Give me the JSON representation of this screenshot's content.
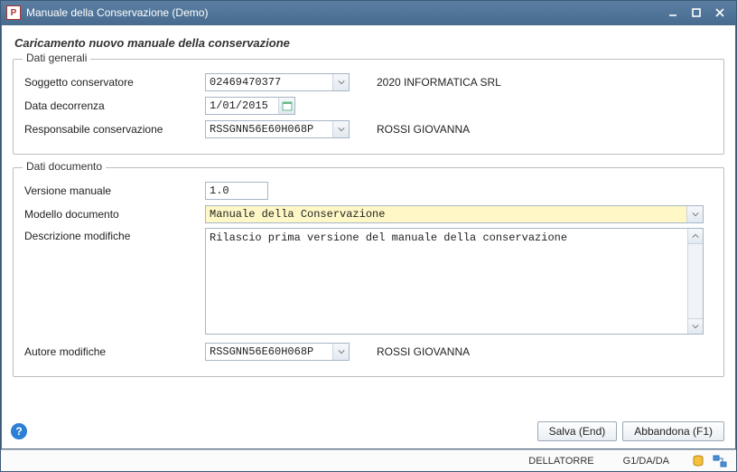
{
  "window": {
    "title": "Manuale della Conservazione  (Demo)"
  },
  "page_title": "Caricamento nuovo manuale della conservazione",
  "group_general": {
    "legend": "Dati generali",
    "subject_label": "Soggetto conservatore",
    "subject_value": "02469470377",
    "subject_name": "2020 INFORMATICA SRL",
    "date_label": "Data decorrenza",
    "date_value": "1/01/2015",
    "resp_label": "Responsabile conservazione",
    "resp_value": "RSSGNN56E60H068P",
    "resp_name": "ROSSI GIOVANNA"
  },
  "group_doc": {
    "legend": "Dati documento",
    "version_label": "Versione manuale",
    "version_value": "1.0",
    "model_label": "Modello documento",
    "model_value": "Manuale della Conservazione",
    "desc_label": "Descrizione modifiche",
    "desc_value": "Rilascio prima versione del manuale della conservazione",
    "author_label": "Autore modifiche",
    "author_value": "RSSGNN56E60H068P",
    "author_name": "ROSSI GIOVANNA"
  },
  "buttons": {
    "save": "Salva (End)",
    "abandon": "Abbandona (F1)"
  },
  "status": {
    "user": "DELLATORRE",
    "context": "G1/DA/DA"
  }
}
